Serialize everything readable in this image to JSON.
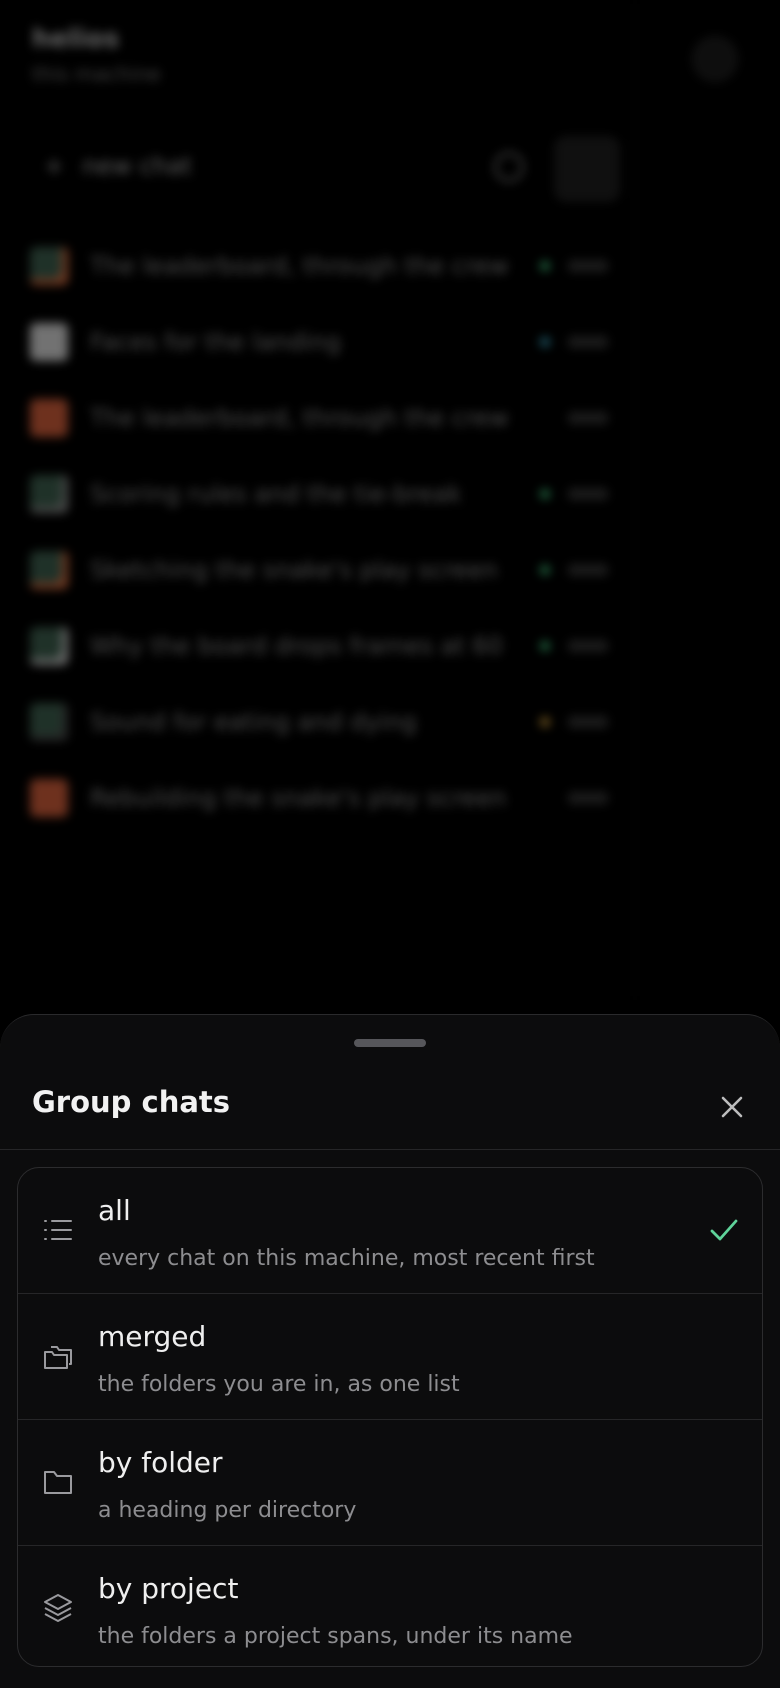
{
  "background": {
    "app_title": "helios",
    "app_subtitle": "this machine",
    "new_chat_label": "new chat",
    "chats": [
      {
        "title": "The leaderboard, through the crew",
        "icon_color": "#3a5a4a",
        "badge_color": "#d86b3e",
        "status_color": "#3fbf7a"
      },
      {
        "title": "Faces for the landing",
        "icon_color": "#cfcfcf",
        "badge_color": "",
        "status_color": "#3aa7c2"
      },
      {
        "title": "The leaderboard, through the crew",
        "icon_color": "#c85a38",
        "badge_color": "",
        "status_color": ""
      },
      {
        "title": "Scoring rules and the tie-break",
        "icon_color": "#3a5a4a",
        "badge_color": "#888888",
        "status_color": "#3fbf7a"
      },
      {
        "title": "Sketching the snake's play screen",
        "icon_color": "#3a5a4a",
        "badge_color": "#d86b3e",
        "status_color": "#3fbf7a"
      },
      {
        "title": "Why the board drops frames at 60",
        "icon_color": "#3a5a4a",
        "badge_color": "#cccccc",
        "status_color": "#3fbf7a"
      },
      {
        "title": "Sound for eating and dying",
        "icon_color": "#3a5a4a",
        "badge_color": "#444444",
        "status_color": "#d6a23c"
      },
      {
        "title": "Rebuilding the snake's play screen",
        "icon_color": "#c85a38",
        "badge_color": "",
        "status_color": ""
      }
    ]
  },
  "sheet": {
    "title": "Group chats",
    "close_icon": "close-icon",
    "options": [
      {
        "label": "all",
        "description": "every chat on this machine, most recent first",
        "icon": "list-icon",
        "selected": true
      },
      {
        "label": "merged",
        "description": "the folders you are in, as one list",
        "icon": "stacked-folders-icon",
        "selected": false
      },
      {
        "label": "by folder",
        "description": "a heading per directory",
        "icon": "folder-icon",
        "selected": false
      },
      {
        "label": "by project",
        "description": "the folders a project spans, under its name",
        "icon": "layers-icon",
        "selected": false
      }
    ]
  },
  "colors": {
    "accent_check": "#5fd39a",
    "sheet_bg": "#0c0c0d"
  }
}
